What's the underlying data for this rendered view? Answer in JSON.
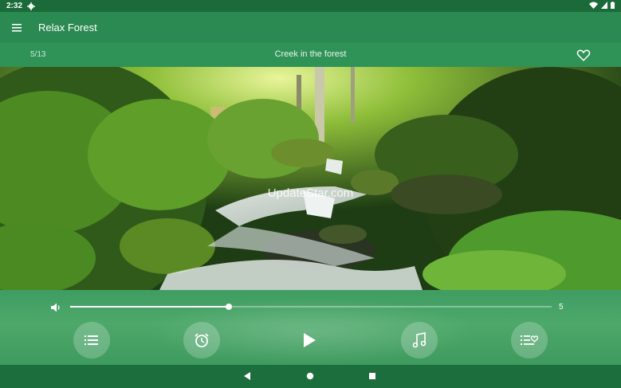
{
  "status": {
    "time": "2:32"
  },
  "app": {
    "title": "Relax Forest"
  },
  "track": {
    "position": "5/13",
    "name": "Creek in the forest"
  },
  "scene": {
    "watermark": "UpdateStar.com"
  },
  "volume": {
    "value": "5",
    "level": 0.33
  },
  "controls": {
    "playlist_icon": "list-icon",
    "timer_icon": "alarm-clock-icon",
    "play_icon": "play-icon",
    "music_icon": "music-note-icon",
    "favorites_icon": "favorite-list-icon"
  },
  "colors": {
    "accent": "#2b8a52",
    "status": "#1b6b3a",
    "track": "#2f9357"
  }
}
